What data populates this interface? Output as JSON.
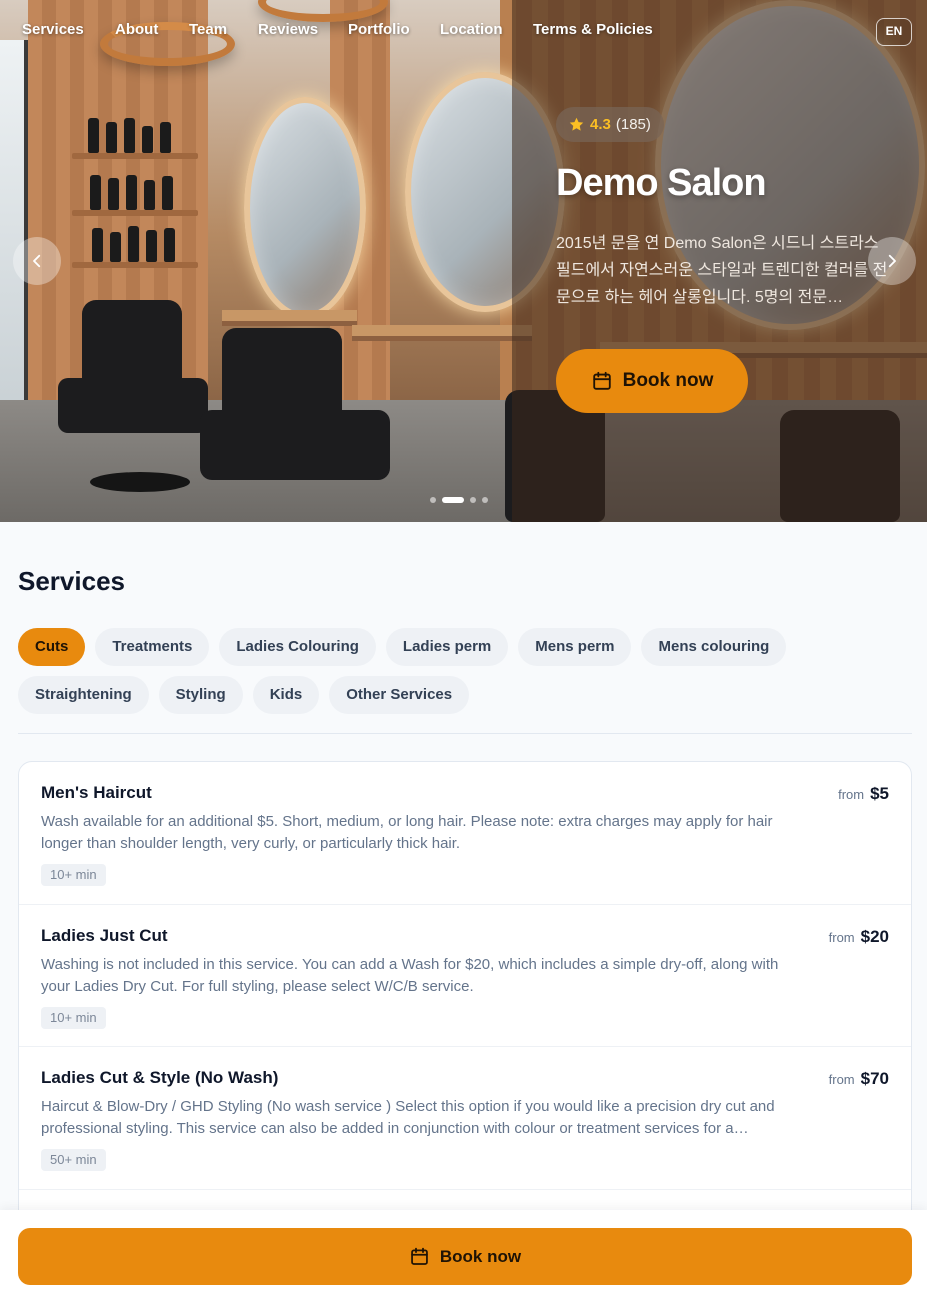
{
  "nav": {
    "items": [
      "Services",
      "About",
      "Team",
      "Reviews",
      "Portfolio",
      "Location",
      "Terms & Policies"
    ],
    "language": "EN"
  },
  "hero": {
    "rating": "4.3",
    "review_count": "(185)",
    "title": "Demo Salon",
    "description": "2015년 문을 연 Demo Salon은 시드니 스트라스필드에서 자연스러운 스타일과 트렌디한 컬러를 전문으로 하는 헤어 살롱입니다. 5명의 전문…",
    "book_label": "Book now",
    "slide_count": 4,
    "active_slide": 2,
    "accent_color": "#e88a0e"
  },
  "services": {
    "title": "Services",
    "categories": [
      "Cuts",
      "Treatments",
      "Ladies Colouring",
      "Ladies perm",
      "Mens perm",
      "Mens colouring",
      "Straightening",
      "Styling",
      "Kids",
      "Other Services"
    ],
    "active_category": "Cuts",
    "items": [
      {
        "name": "Men's Haircut",
        "description": "Wash available for an additional $5. Short, medium, or long hair. Please note: extra charges may apply for hair longer than shoulder length, very curly, or particularly thick hair.",
        "duration": "10+ min",
        "price_prefix": "from",
        "price": "$5"
      },
      {
        "name": "Ladies Just Cut",
        "description": "Washing is not included in this service. You can add a Wash for $20, which includes a simple dry-off, along with your Ladies Dry Cut. For full styling, please select W/C/B service.",
        "duration": "10+ min",
        "price_prefix": "from",
        "price": "$20"
      },
      {
        "name": "Ladies Cut & Style (No Wash)",
        "description": "Haircut & Blow-Dry / GHD Styling (No wash service ) Select this option if you would like a precision dry cut and professional styling. This service can also be added in conjunction with colour or treatment services for a…",
        "duration": "50+ min",
        "price_prefix": "from",
        "price": "$70"
      }
    ]
  },
  "footer": {
    "book_label": "Book now"
  }
}
